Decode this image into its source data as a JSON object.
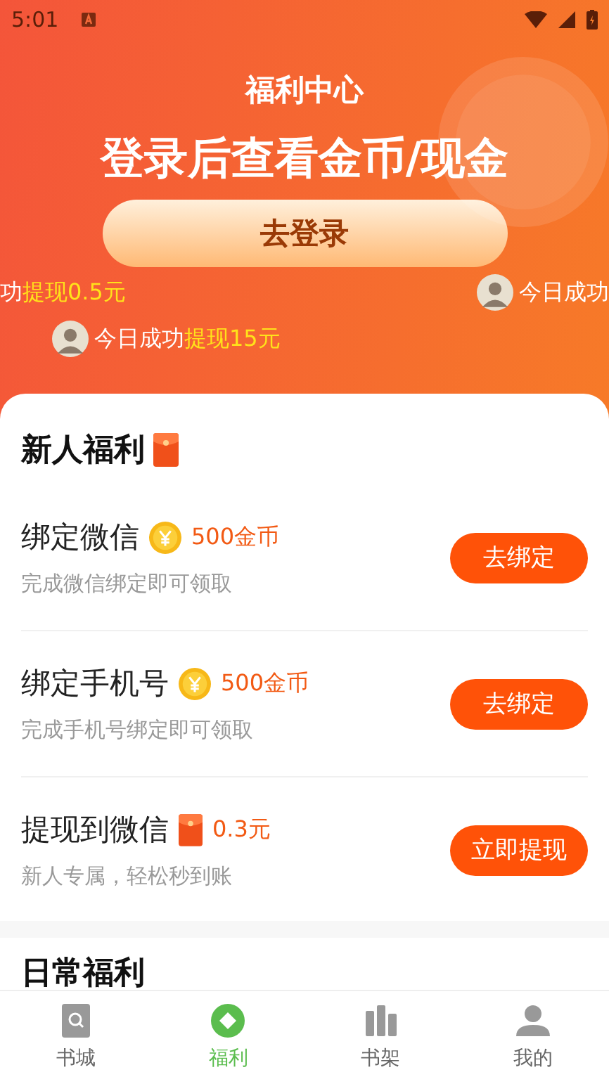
{
  "status_bar": {
    "time": "5:01"
  },
  "header": {
    "title": "福利中心",
    "headline": "登录后查看金币/现金",
    "login_button": "去登录"
  },
  "ticker_rows": [
    [
      {
        "kind": "plain",
        "text": "功",
        "highlight": "提现0.5元"
      },
      {
        "kind": "avatar",
        "text": "今日成功"
      }
    ],
    [
      {
        "kind": "avatar",
        "text": "今日成功",
        "highlight": "提现15元"
      }
    ]
  ],
  "new_user": {
    "title": "新人福利",
    "items": [
      {
        "title": "绑定微信",
        "kind": "coin",
        "reward": "500金币",
        "subtitle": "完成微信绑定即可领取",
        "button": "去绑定"
      },
      {
        "title": "绑定手机号",
        "kind": "coin",
        "reward": "500金币",
        "subtitle": "完成手机号绑定即可领取",
        "button": "去绑定"
      },
      {
        "title": "提现到微信",
        "kind": "envelope",
        "reward": "0.3元",
        "subtitle": "新人专属，轻松秒到账",
        "button": "立即提现"
      }
    ]
  },
  "daily": {
    "title": "日常福利"
  },
  "tab_bar": [
    {
      "label": "书城",
      "selected": false
    },
    {
      "label": "福利",
      "selected": true
    },
    {
      "label": "书架",
      "selected": false
    },
    {
      "label": "我的",
      "selected": false
    }
  ]
}
